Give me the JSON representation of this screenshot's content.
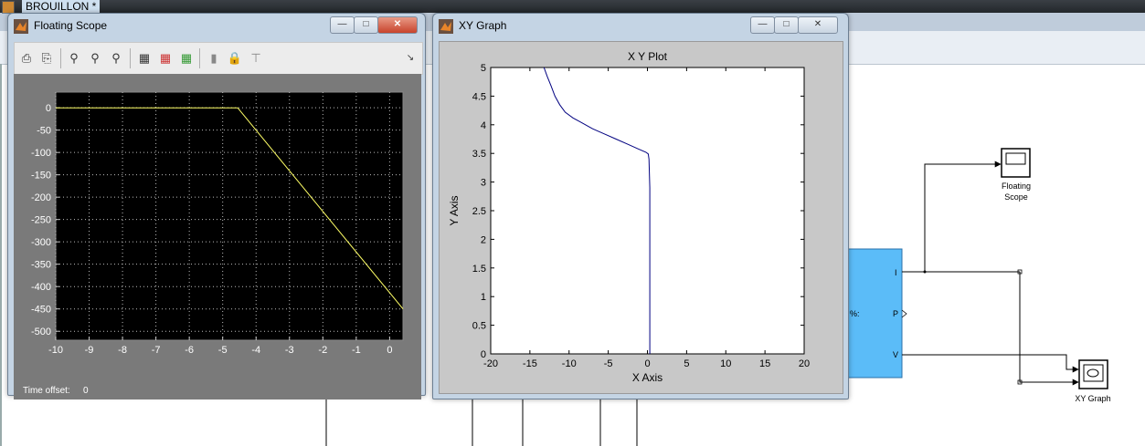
{
  "model_window": {
    "title": "BROUILLON *"
  },
  "scope_window": {
    "title": "Floating Scope",
    "controls": [
      "minimize",
      "maximize",
      "close"
    ],
    "toolbar_icons": [
      "print-icon",
      "print-preview-icon",
      "zoom-icon",
      "zoom-x-icon",
      "zoom-y-icon",
      "autoscale-icon",
      "save-axes-icon",
      "restore-axes-icon",
      "params-icon",
      "lock-icon",
      "signal-select-icon"
    ],
    "time_offset_label": "Time offset:",
    "time_offset_value": "0"
  },
  "xy_window": {
    "title": "XY Graph",
    "controls": [
      "minimize",
      "maximize",
      "close"
    ]
  },
  "blocks": {
    "floating_scope_label_1": "Floating",
    "floating_scope_label_2": "Scope",
    "xy_graph_label": "XY Graph",
    "subsystem_port_i": "I",
    "subsystem_port_p": "P",
    "subsystem_port_v": "V",
    "subsystem_text": "%:",
    "block_color": "#5bbcf8"
  },
  "chart_data": [
    {
      "type": "line",
      "name": "scope",
      "title": "",
      "xlabel": "",
      "ylabel": "",
      "xlim": [
        -10,
        0.4
      ],
      "ylim": [
        -520,
        35
      ],
      "xticks": [
        -10,
        -9,
        -8,
        -7,
        -6,
        -5,
        -4,
        -3,
        -2,
        -1,
        0
      ],
      "yticks": [
        0,
        -50,
        -100,
        -150,
        -200,
        -250,
        -300,
        -350,
        -400,
        -450,
        -500
      ],
      "grid": true,
      "background": "#000000",
      "line_color": "#ffff66",
      "x": [
        -10,
        -4.55,
        0.4
      ],
      "y": [
        0,
        0,
        -450
      ]
    },
    {
      "type": "line",
      "name": "xy",
      "title": "X Y Plot",
      "xlabel": "X Axis",
      "ylabel": "Y Axis",
      "xlim": [
        -20,
        20
      ],
      "ylim": [
        0,
        5
      ],
      "xticks": [
        -20,
        -15,
        -10,
        -5,
        0,
        5,
        10,
        15,
        20
      ],
      "yticks": [
        0,
        0.5,
        1,
        1.5,
        2,
        2.5,
        3,
        3.5,
        4,
        4.5,
        5
      ],
      "grid": false,
      "line_color": "#000080",
      "x": [
        -13.2,
        -12.8,
        -12.3,
        -11.8,
        -11.2,
        -10.5,
        -9.5,
        -8.3,
        -7,
        -5.5,
        -4,
        -2.5,
        -1.2,
        -0.2,
        0.1,
        0.2,
        0.3,
        0.3,
        0.3
      ],
      "y": [
        5,
        4.85,
        4.68,
        4.5,
        4.35,
        4.22,
        4.12,
        4.03,
        3.93,
        3.84,
        3.75,
        3.66,
        3.58,
        3.52,
        3.49,
        3.4,
        2.9,
        1,
        0
      ]
    }
  ]
}
